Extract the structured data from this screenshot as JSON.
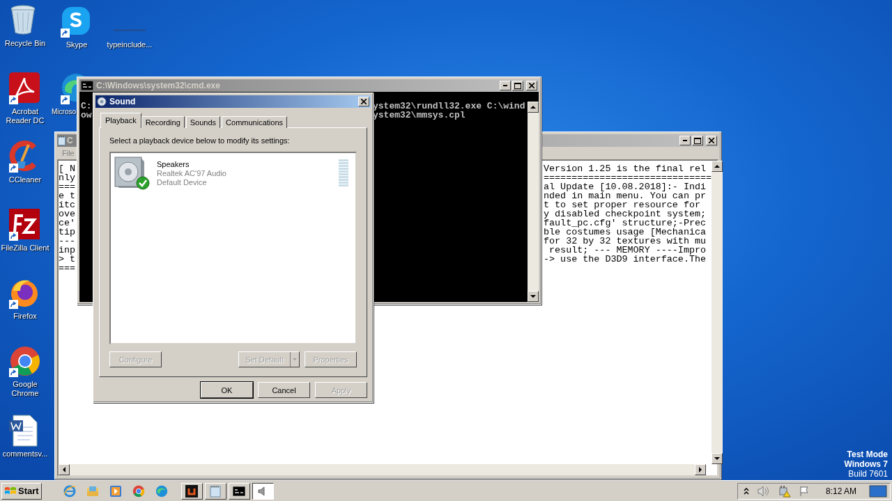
{
  "desktop_icons": [
    {
      "label": "Recycle Bin",
      "kind": "recycle",
      "shortcut": false
    },
    {
      "label": "Skype",
      "kind": "skype",
      "shortcut": true
    },
    {
      "label": "typeinclude...",
      "kind": "blank",
      "shortcut": false
    },
    {
      "label": "Acrobat Reader DC",
      "kind": "acrobat",
      "shortcut": true
    },
    {
      "label": "Microso",
      "kind": "edge",
      "shortcut": true
    },
    {
      "label": "CCleaner",
      "kind": "ccleaner",
      "shortcut": true
    },
    {
      "label": "FileZilla Client",
      "kind": "filezilla",
      "shortcut": true
    },
    {
      "label": "Firefox",
      "kind": "firefox",
      "shortcut": true
    },
    {
      "label": "Google Chrome",
      "kind": "chrome",
      "shortcut": true
    },
    {
      "label": "commentsv...",
      "kind": "word",
      "shortcut": false
    }
  ],
  "notepad_window": {
    "title": "C",
    "menu": [
      "File"
    ],
    "lines": [
      {
        "left": "[ N",
        "right": "Version 1.25 is the final rel"
      },
      {
        "left": "nly",
        "right": "=============================="
      },
      {
        "left": "===",
        "right": "al Update [10.08.2018]:- Indi"
      },
      {
        "left": "e t",
        "right": "nded in main menu. You can pr"
      },
      {
        "left": "itc",
        "right": "t to set proper resource for"
      },
      {
        "left": "ove",
        "right": "y disabled checkpoint system;"
      },
      {
        "left": "ce'",
        "right": "fault_pc.cfg' structure;-Prec"
      },
      {
        "left": "tip",
        "right": "ble costumes usage [Mechanica"
      },
      {
        "left": "---",
        "right": "for 32 by 32 textures with mu"
      },
      {
        "left": "inp",
        "right": " result; --- MEMORY ----Impro"
      },
      {
        "left": "> t",
        "right": "-> use the D3D9 interface.The"
      },
      {
        "left": "==="
      }
    ]
  },
  "cmd_window": {
    "title": "C:\\Windows\\system32\\cmd.exe",
    "lines": [
      {
        "left": "C:",
        "right": "ystem32\\rundll32.exe C:\\wind"
      },
      {
        "left": "ow",
        "right": "ystem32\\mmsys.cpl"
      }
    ]
  },
  "sound_dialog": {
    "title": "Sound",
    "tabs": [
      {
        "label": "Playback",
        "selected": true
      },
      {
        "label": "Recording",
        "selected": false
      },
      {
        "label": "Sounds",
        "selected": false
      },
      {
        "label": "Communications",
        "selected": false
      }
    ],
    "instruction": "Select a playback device below to modify its settings:",
    "devices": [
      {
        "name": "Speakers",
        "driver": "Realtek AC'97 Audio",
        "status": "Default Device",
        "default": true
      }
    ],
    "device_buttons": [
      {
        "label": "Configure",
        "kind": "button",
        "disabled": true
      },
      {
        "label": "Set Default",
        "kind": "split",
        "disabled": true
      },
      {
        "label": "Properties",
        "kind": "button",
        "disabled": true
      }
    ],
    "dialog_buttons": [
      {
        "label": "OK",
        "default": true,
        "disabled": false
      },
      {
        "label": "Cancel",
        "default": false,
        "disabled": false
      },
      {
        "label": "Apply",
        "default": false,
        "disabled": true
      }
    ]
  },
  "taskbar": {
    "start": "Start",
    "quick_launch": [
      {
        "kind": "ie"
      },
      {
        "kind": "explorer"
      },
      {
        "kind": "media"
      },
      {
        "kind": "chrome"
      },
      {
        "kind": "edge"
      }
    ],
    "tasks": [
      {
        "kind": "app",
        "selected": false
      },
      {
        "kind": "notepad",
        "selected": false
      },
      {
        "kind": "cmd",
        "selected": false
      },
      {
        "kind": "sound",
        "selected": true
      }
    ],
    "tray": [
      {
        "kind": "chevron"
      },
      {
        "kind": "volume"
      },
      {
        "kind": "network"
      },
      {
        "kind": "flag"
      }
    ],
    "clock": "8:12 AM"
  },
  "os_notice": [
    {
      "text": "Test Mode",
      "bold": true
    },
    {
      "text": "Windows 7",
      "bold": true
    },
    {
      "text": "Build 7601",
      "bold": false
    }
  ]
}
